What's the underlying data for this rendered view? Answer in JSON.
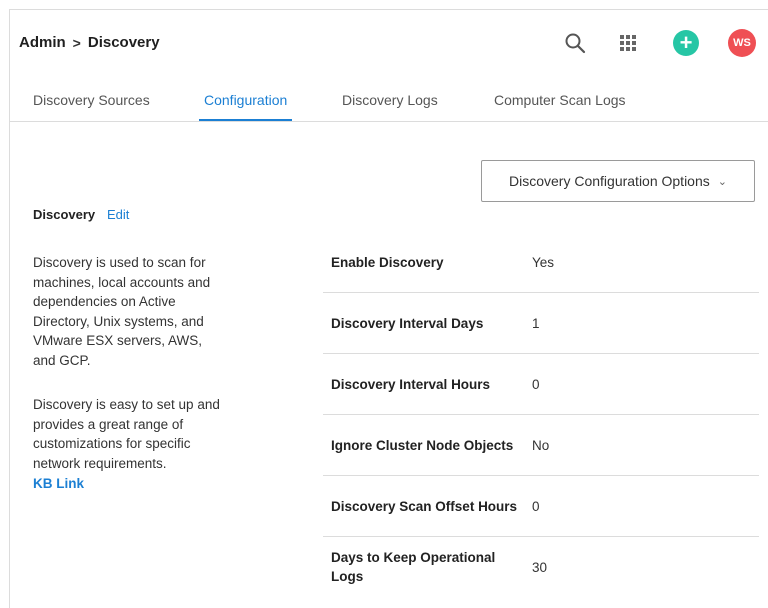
{
  "breadcrumb": {
    "parent": "Admin",
    "separator": ">",
    "current": "Discovery"
  },
  "header": {
    "icons": [
      "search-icon",
      "apps-grid-icon",
      "add-icon",
      "avatar"
    ],
    "avatar_initials": "WS",
    "colors": {
      "add": "#26c6a5",
      "avatar": "#ef4f54",
      "accent": "#1b7fd3"
    }
  },
  "tabs": [
    {
      "label": "Discovery Sources",
      "active": false
    },
    {
      "label": "Configuration",
      "active": true
    },
    {
      "label": "Discovery Logs",
      "active": false
    },
    {
      "label": "Computer Scan Logs",
      "active": false
    }
  ],
  "options_button": {
    "label": "Discovery Configuration Options"
  },
  "section": {
    "title": "Discovery",
    "edit_label": "Edit",
    "description_1_lines": [
      "Discovery is used to scan for",
      "machines, local accounts and",
      "dependencies on Active",
      "Directory, Unix systems, and",
      "VMware ESX servers, AWS,",
      "and GCP."
    ],
    "description_2_lines": [
      "Discovery is easy to set up and",
      "provides a great range of",
      "customizations for specific",
      "network requirements."
    ],
    "kb_link": "KB Link"
  },
  "settings": [
    {
      "label": "Enable Discovery",
      "value": "Yes"
    },
    {
      "label": "Discovery Interval Days",
      "value": "1"
    },
    {
      "label": "Discovery Interval Hours",
      "value": "0"
    },
    {
      "label": "Ignore Cluster Node Objects",
      "value": "No"
    },
    {
      "label": "Discovery Scan Offset Hours",
      "value": "0"
    },
    {
      "label": "Days to Keep Operational Logs",
      "value": "30"
    }
  ]
}
